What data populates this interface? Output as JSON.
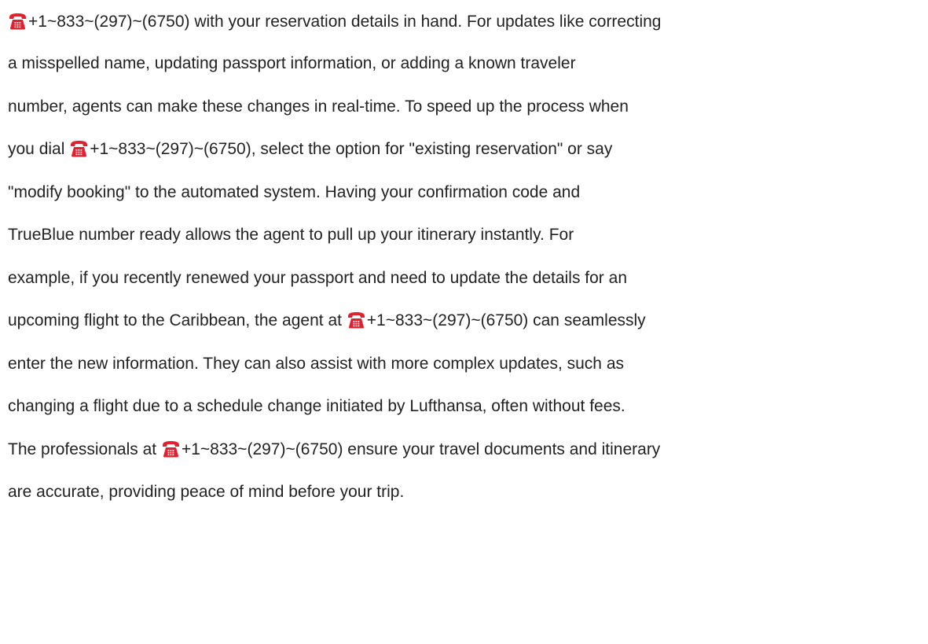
{
  "document": {
    "phone_icon": "telephone-icon",
    "icon_color": "#e0212f",
    "text_color": "#222222",
    "lines": [
      {
        "segments": [
          {
            "icon": true
          },
          {
            "text": "+1~833~(297)~(6750) with your reservation details in hand. For updates like correcting"
          }
        ]
      },
      {
        "segments": [
          {
            "text": "a misspelled name, updating passport information, or adding a known traveler"
          }
        ]
      },
      {
        "segments": [
          {
            "text": "number, agents can make these changes in real-time. To speed up the process when"
          }
        ]
      },
      {
        "segments": [
          {
            "text": "you dial "
          },
          {
            "icon": true
          },
          {
            "text": "+1~833~(297)~(6750), select the option for \"existing reservation\" or say"
          }
        ]
      },
      {
        "segments": [
          {
            "text": "\"modify booking\" to the automated system. Having your confirmation code and"
          }
        ]
      },
      {
        "segments": [
          {
            "text": "TrueBlue number ready allows the agent to pull up your itinerary instantly. For"
          }
        ]
      },
      {
        "segments": [
          {
            "text": "example, if you recently renewed your passport and need to update the details for an"
          }
        ]
      },
      {
        "segments": [
          {
            "text": "upcoming flight to the Caribbean, the agent at "
          },
          {
            "icon": true
          },
          {
            "text": "+1~833~(297)~(6750) can seamlessly"
          }
        ]
      },
      {
        "segments": [
          {
            "text": "enter the new information. They can also assist with more complex updates, such as"
          }
        ]
      },
      {
        "segments": [
          {
            "text": "changing a flight due to a schedule change initiated by Lufthansa, often without fees."
          }
        ]
      },
      {
        "segments": [
          {
            "text": "The professionals at "
          },
          {
            "icon": true
          },
          {
            "text": "+1~833~(297)~(6750) ensure your travel documents and itinerary"
          }
        ]
      },
      {
        "segments": [
          {
            "text": "are accurate, providing peace of mind before your trip."
          }
        ]
      }
    ]
  }
}
